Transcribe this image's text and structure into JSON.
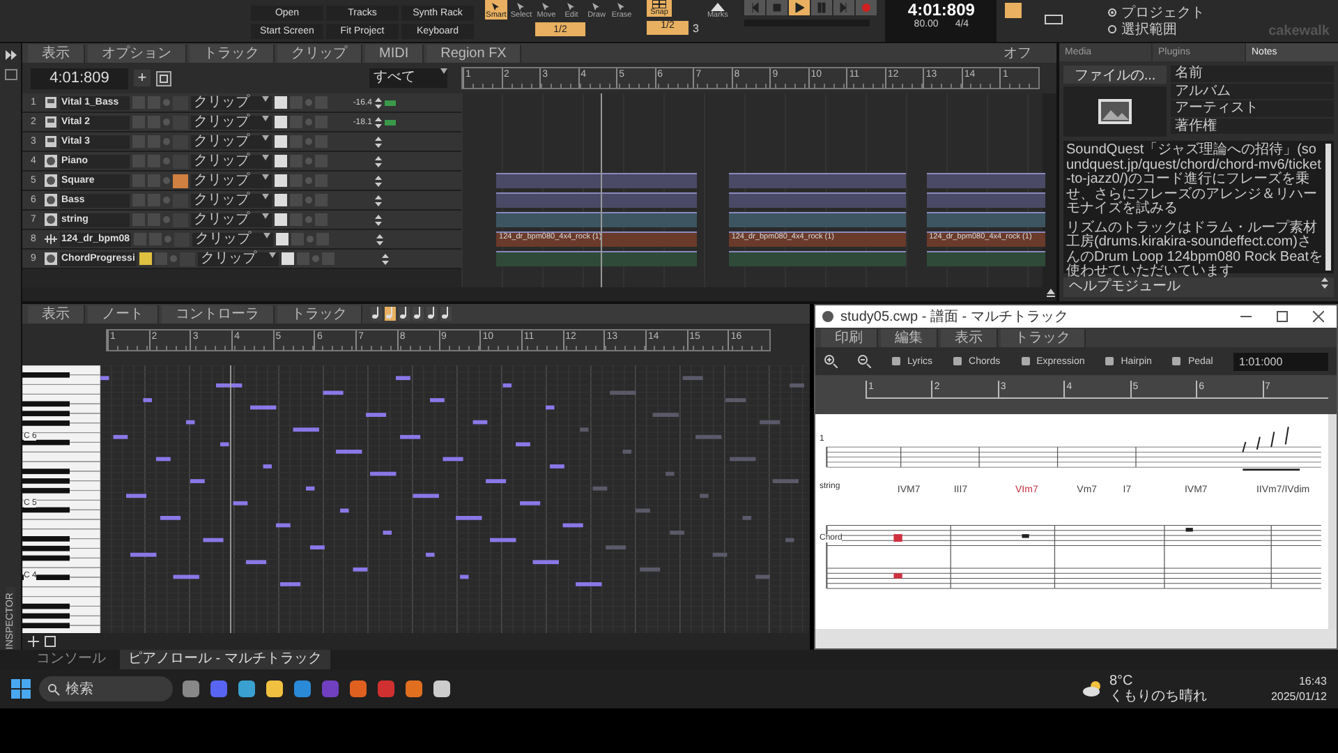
{
  "toolbar": {
    "view_buttons": [
      "Open",
      "Tracks",
      "Synth Rack",
      "Start Screen",
      "Fit Project",
      "Keyboard"
    ],
    "tools": [
      {
        "label": "Smart",
        "selected": true
      },
      {
        "label": "Select",
        "selected": false
      },
      {
        "label": "Move",
        "selected": false
      },
      {
        "label": "Edit",
        "selected": false
      },
      {
        "label": "Draw",
        "selected": false
      },
      {
        "label": "Erase",
        "selected": false
      }
    ],
    "tool_resolution": "1/2",
    "snap": {
      "label": "Snap",
      "on": true,
      "value": "1/2",
      "extra": "3"
    },
    "marks_label": "Marks",
    "transport": {
      "playing": true,
      "time": "4:01:809",
      "tempo": "80.00",
      "meter": "4/4",
      "metronome_on": true
    },
    "scope": [
      {
        "label": "プロジェクト",
        "selected": true
      },
      {
        "label": "選択範囲",
        "selected": false
      }
    ],
    "logo": "cakewalk"
  },
  "inspector_label": "INSPECTOR",
  "track_view": {
    "menus": [
      "表示",
      "オプション",
      "トラック",
      "クリップ",
      "MIDI",
      "Region FX"
    ],
    "time": "4:01:809",
    "add_button": "+",
    "filter": "すべて",
    "automation": "オフ",
    "ruler": [
      "1",
      "2",
      "3",
      "4",
      "5",
      "6",
      "7",
      "8",
      "9",
      "10",
      "11",
      "12",
      "13",
      "14",
      "1"
    ],
    "tracks": [
      {
        "number": "1",
        "name": "Vital 1_Bass",
        "kind": "synth",
        "muted": false,
        "echo": false,
        "mode": "クリップ",
        "volume": "-16.4"
      },
      {
        "number": "2",
        "name": "Vital 2",
        "kind": "synth",
        "muted": false,
        "echo": false,
        "mode": "クリップ",
        "volume": "-18.1"
      },
      {
        "number": "3",
        "name": "Vital 3",
        "kind": "synth",
        "muted": false,
        "echo": false,
        "mode": "クリップ"
      },
      {
        "number": "4",
        "name": "Piano",
        "kind": "instrument",
        "muted": false,
        "echo": false,
        "mode": "クリップ"
      },
      {
        "number": "5",
        "name": "Square",
        "kind": "instrument",
        "muted": false,
        "echo": true,
        "mode": "クリップ"
      },
      {
        "number": "6",
        "name": "Bass",
        "kind": "instrument",
        "muted": false,
        "echo": false,
        "mode": "クリップ"
      },
      {
        "number": "7",
        "name": "string",
        "kind": "instrument",
        "muted": false,
        "echo": false,
        "mode": "クリップ"
      },
      {
        "number": "8",
        "name": "124_dr_bpm08",
        "kind": "audio",
        "muted": false,
        "echo": false,
        "mode": "クリップ",
        "clips": [
          "124_dr_bpm080_4x4_rock (1)",
          "124_dr_bpm080_4x4_rock (1)",
          "124_dr_bpm080_4x4_rock (1)"
        ]
      },
      {
        "number": "9",
        "name": "ChordProgressi",
        "kind": "instrument",
        "muted": true,
        "echo": false,
        "mode": "クリップ"
      }
    ]
  },
  "right_panel": {
    "tabs": [
      {
        "label": "Media",
        "selected": false
      },
      {
        "label": "Plugins",
        "selected": false
      },
      {
        "label": "Notes",
        "selected": true
      }
    ],
    "file_button": "ファイルの...",
    "fields": [
      "名前",
      "アルバム",
      "アーティスト",
      "著作権"
    ],
    "notes": [
      "SoundQuest「ジャズ理論への招待」(soundquest.jp/quest/chord/chord-mv6/ticket-to-jazz0/)のコード進行にフレーズを乗せ、さらにフレーズのアレンジ＆リハーモナイズを試みる",
      "リズムのトラックはドラム・ループ素材工房(drums.kirakira-soundeffect.com)さんのDrum Loop 124bpm080 Rock Beatを使わせていただいています"
    ],
    "help": "ヘルプモジュール"
  },
  "piano_roll": {
    "menus": [
      "表示",
      "ノート",
      "コントローラ",
      "トラック"
    ],
    "ruler": [
      "1",
      "2",
      "3",
      "4",
      "5",
      "6",
      "7",
      "8",
      "9",
      "10",
      "11",
      "12",
      "13",
      "14",
      "15",
      "16"
    ],
    "key_labels": [
      "C 6",
      "C 5",
      "C 4"
    ]
  },
  "staff_window": {
    "title": "study05.cwp - 譜面 - マルチトラック",
    "menus": [
      "印刷",
      "編集",
      "表示",
      "トラック"
    ],
    "tools": [
      "Lyrics",
      "Chords",
      "Expression",
      "Hairpin",
      "Pedal"
    ],
    "time": "1:01:000",
    "ruler": [
      "1",
      "2",
      "3",
      "4",
      "5",
      "6",
      "7"
    ],
    "staff_labels": [
      "1",
      "string",
      "Chord"
    ],
    "chords": [
      {
        "label": "IVM7",
        "color": "#444444"
      },
      {
        "label": "III7",
        "color": "#444444"
      },
      {
        "label": "VIm7",
        "color": "#c03040"
      },
      {
        "label": "Vm7",
        "color": "#444444"
      },
      {
        "label": "I7",
        "color": "#444444"
      },
      {
        "label": "IVM7",
        "color": "#444444"
      },
      {
        "label": "IIVm7/IVdim",
        "color": "#444444"
      }
    ]
  },
  "bottom_tabs": [
    {
      "label": "コンソール",
      "selected": false
    },
    {
      "label": "ピアノロール - マルチトラック",
      "selected": true
    }
  ],
  "taskbar": {
    "search": "検索",
    "temperature": "8°C",
    "weather": "くもりのち晴れ",
    "time": "16:43",
    "date": "2025/01/12"
  }
}
